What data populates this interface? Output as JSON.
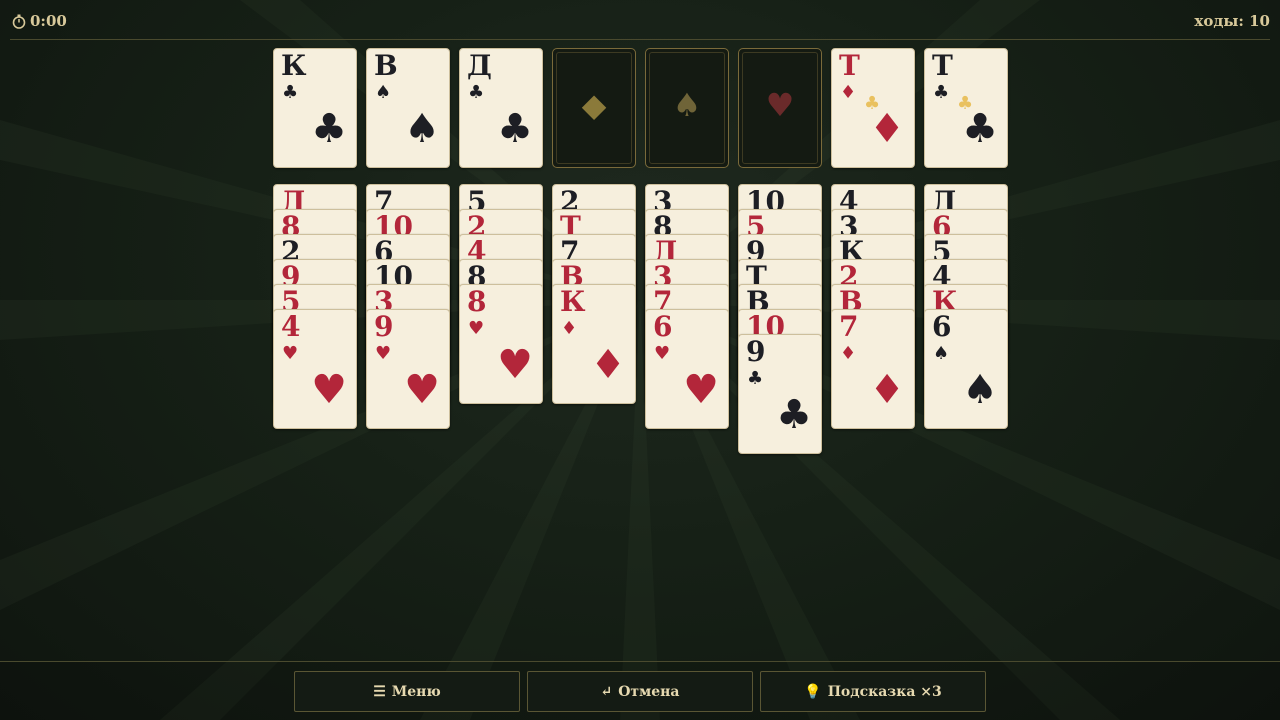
{
  "header": {
    "timer": "0:00",
    "moves_label": "ходы: 10"
  },
  "foundation": [
    {
      "rank": "К",
      "suit": "♣",
      "color": "black"
    },
    {
      "rank": "В",
      "suit": "♠",
      "color": "black"
    },
    {
      "rank": "Д",
      "suit": "♣",
      "color": "black"
    },
    {
      "empty": true,
      "mark": "◆",
      "mark_color": "#8b7a3a"
    },
    {
      "empty": true,
      "mark": "♠",
      "mark_color": "#6f6438"
    },
    {
      "empty": true,
      "mark": "♥",
      "mark_color": "#6a2a2a"
    },
    {
      "rank": "Т",
      "suit": "♦",
      "color": "red",
      "accent": "♣"
    },
    {
      "rank": "Т",
      "suit": "♣",
      "color": "black",
      "accent": "♣"
    }
  ],
  "tableau": [
    [
      {
        "rank": "Д",
        "color": "red"
      },
      {
        "rank": "8",
        "color": "red"
      },
      {
        "rank": "2",
        "color": "black"
      },
      {
        "rank": "9",
        "color": "red"
      },
      {
        "rank": "5",
        "color": "red"
      },
      {
        "rank": "4",
        "suit": "♥",
        "color": "red"
      }
    ],
    [
      {
        "rank": "7",
        "color": "black"
      },
      {
        "rank": "10",
        "color": "red"
      },
      {
        "rank": "6",
        "color": "black"
      },
      {
        "rank": "10",
        "color": "black"
      },
      {
        "rank": "3",
        "color": "red"
      },
      {
        "rank": "9",
        "suit": "♥",
        "color": "red"
      }
    ],
    [
      {
        "rank": "5",
        "color": "black"
      },
      {
        "rank": "2",
        "color": "red"
      },
      {
        "rank": "4",
        "color": "red"
      },
      {
        "rank": "8",
        "color": "black"
      },
      {
        "rank": "8",
        "suit": "♥",
        "color": "red"
      }
    ],
    [
      {
        "rank": "2",
        "color": "black"
      },
      {
        "rank": "Т",
        "color": "red"
      },
      {
        "rank": "7",
        "color": "black"
      },
      {
        "rank": "В",
        "color": "red"
      },
      {
        "rank": "К",
        "suit": "♦",
        "color": "red"
      }
    ],
    [
      {
        "rank": "3",
        "color": "black"
      },
      {
        "rank": "8",
        "color": "black"
      },
      {
        "rank": "Д",
        "color": "red"
      },
      {
        "rank": "3",
        "color": "red"
      },
      {
        "rank": "7",
        "color": "red"
      },
      {
        "rank": "6",
        "suit": "♥",
        "color": "red"
      }
    ],
    [
      {
        "rank": "10",
        "color": "black"
      },
      {
        "rank": "5",
        "color": "red"
      },
      {
        "rank": "9",
        "color": "black"
      },
      {
        "rank": "Т",
        "color": "black"
      },
      {
        "rank": "В",
        "color": "black"
      },
      {
        "rank": "10",
        "color": "red"
      },
      {
        "rank": "9",
        "suit": "♣",
        "color": "black"
      }
    ],
    [
      {
        "rank": "4",
        "color": "black"
      },
      {
        "rank": "3",
        "color": "black"
      },
      {
        "rank": "К",
        "color": "black"
      },
      {
        "rank": "2",
        "color": "red"
      },
      {
        "rank": "В",
        "color": "red"
      },
      {
        "rank": "7",
        "suit": "♦",
        "color": "red"
      }
    ],
    [
      {
        "rank": "Д",
        "color": "black"
      },
      {
        "rank": "6",
        "color": "red"
      },
      {
        "rank": "5",
        "color": "black"
      },
      {
        "rank": "4",
        "color": "black"
      },
      {
        "rank": "К",
        "color": "red"
      },
      {
        "rank": "6",
        "suit": "♠",
        "color": "black"
      }
    ]
  ],
  "footer": {
    "menu": {
      "icon": "☰",
      "label": "Меню"
    },
    "undo": {
      "icon": "↵",
      "label": "Отмена"
    },
    "hint": {
      "icon": "💡",
      "label": "Подсказка ×3"
    }
  },
  "colors": {
    "red": "#b3263a",
    "black": "#1d1e24",
    "card_face": "#f6efdd",
    "gold": "#d8c99a"
  }
}
